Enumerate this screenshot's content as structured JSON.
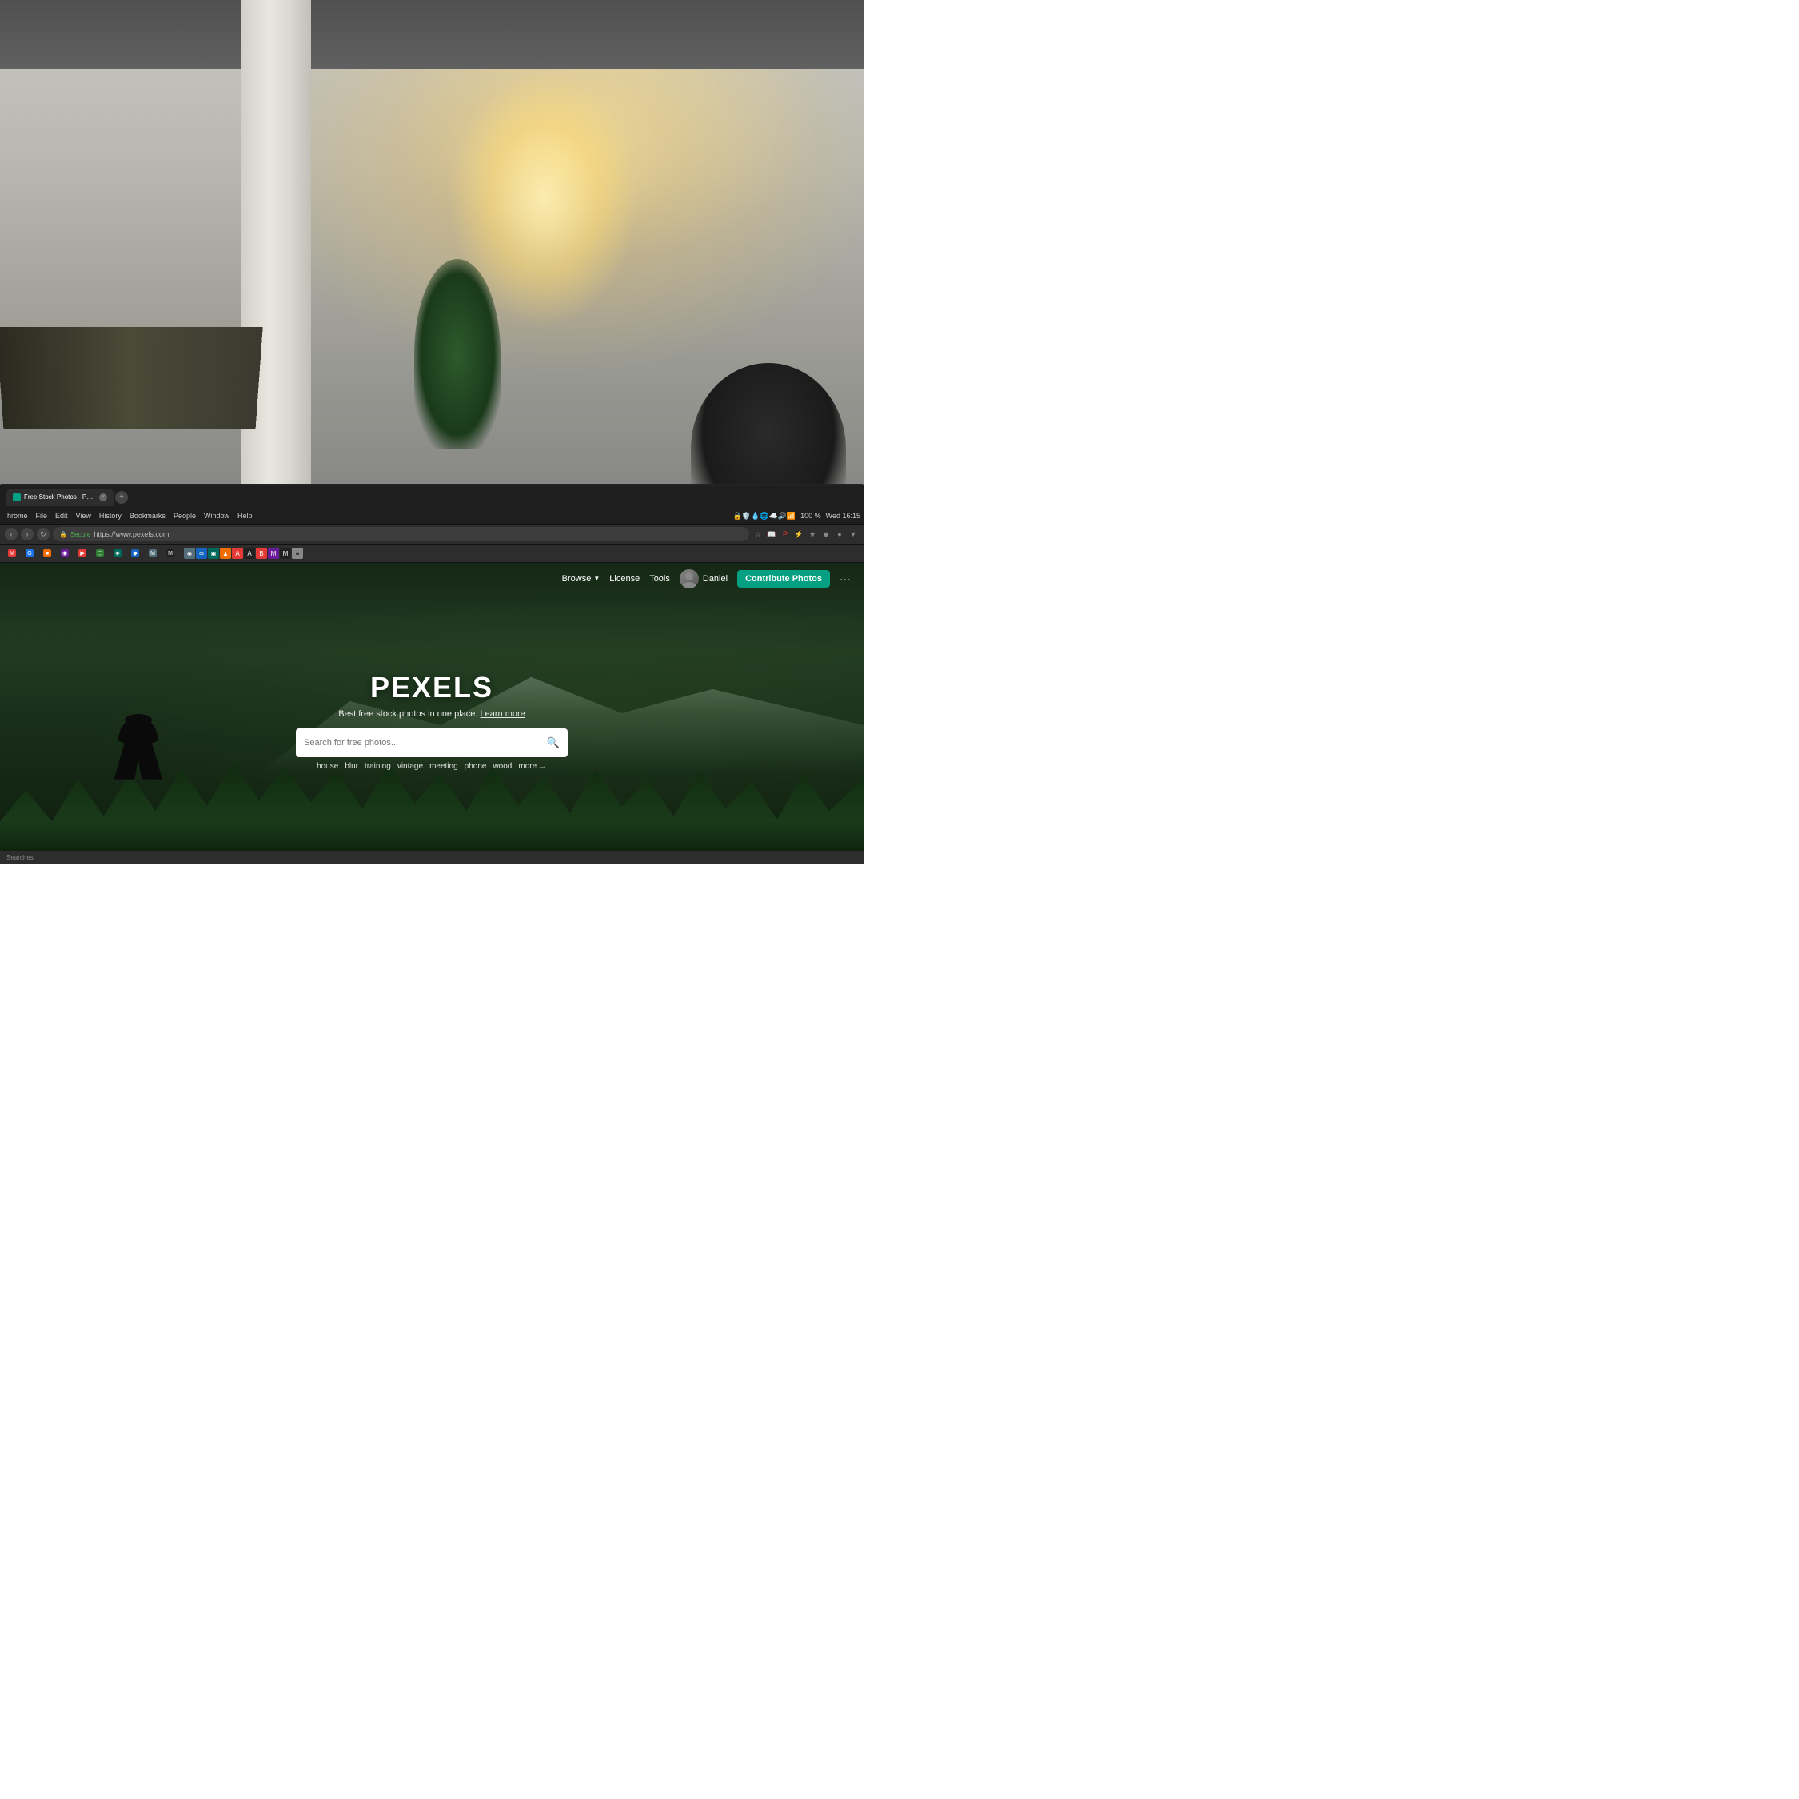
{
  "background": {
    "type": "office_photo"
  },
  "browser": {
    "tab": {
      "label": "Free Stock Photos · Pexels",
      "favicon_color": "#05a081"
    },
    "menu": {
      "items": [
        "hrome",
        "File",
        "Edit",
        "View",
        "History",
        "Bookmarks",
        "People",
        "Window",
        "Help"
      ]
    },
    "system": {
      "time": "Wed 16:15",
      "battery": "100 %",
      "battery_icon": "🔋"
    },
    "address": {
      "secure_label": "Secure",
      "url": "https://www.pexels.com"
    },
    "bookmarks": [
      {
        "favicon": "M",
        "color": "#e53935"
      },
      {
        "favicon": "◆",
        "color": "#1a73e8"
      },
      {
        "favicon": "●",
        "color": "#ef6c00"
      },
      {
        "favicon": "■",
        "color": "#1565c0"
      },
      {
        "favicon": "◉",
        "color": "#6a1b9a"
      },
      {
        "favicon": "⬟",
        "color": "#e53935"
      },
      {
        "favicon": "▶",
        "color": "#e53935"
      },
      {
        "favicon": "⬡",
        "color": "#2e7d32"
      },
      {
        "favicon": "◈",
        "color": "#00695c"
      },
      {
        "favicon": "◆",
        "color": "#1565c0"
      },
      {
        "favicon": "⬤",
        "color": "#546e7a"
      }
    ]
  },
  "pexels": {
    "nav": {
      "browse_label": "Browse",
      "license_label": "License",
      "tools_label": "Tools",
      "user_name": "Daniel",
      "contribute_label": "Contribute Photos",
      "more_label": "···"
    },
    "hero": {
      "logo": "PEXELS",
      "tagline": "Best free stock photos in one place.",
      "tagline_link": "Learn more",
      "search_placeholder": "Search for free photos...",
      "tags": [
        "house",
        "blur",
        "training",
        "vintage",
        "meeting",
        "phone",
        "wood"
      ],
      "more_tag": "more →"
    }
  },
  "status": {
    "text": "Searches"
  }
}
